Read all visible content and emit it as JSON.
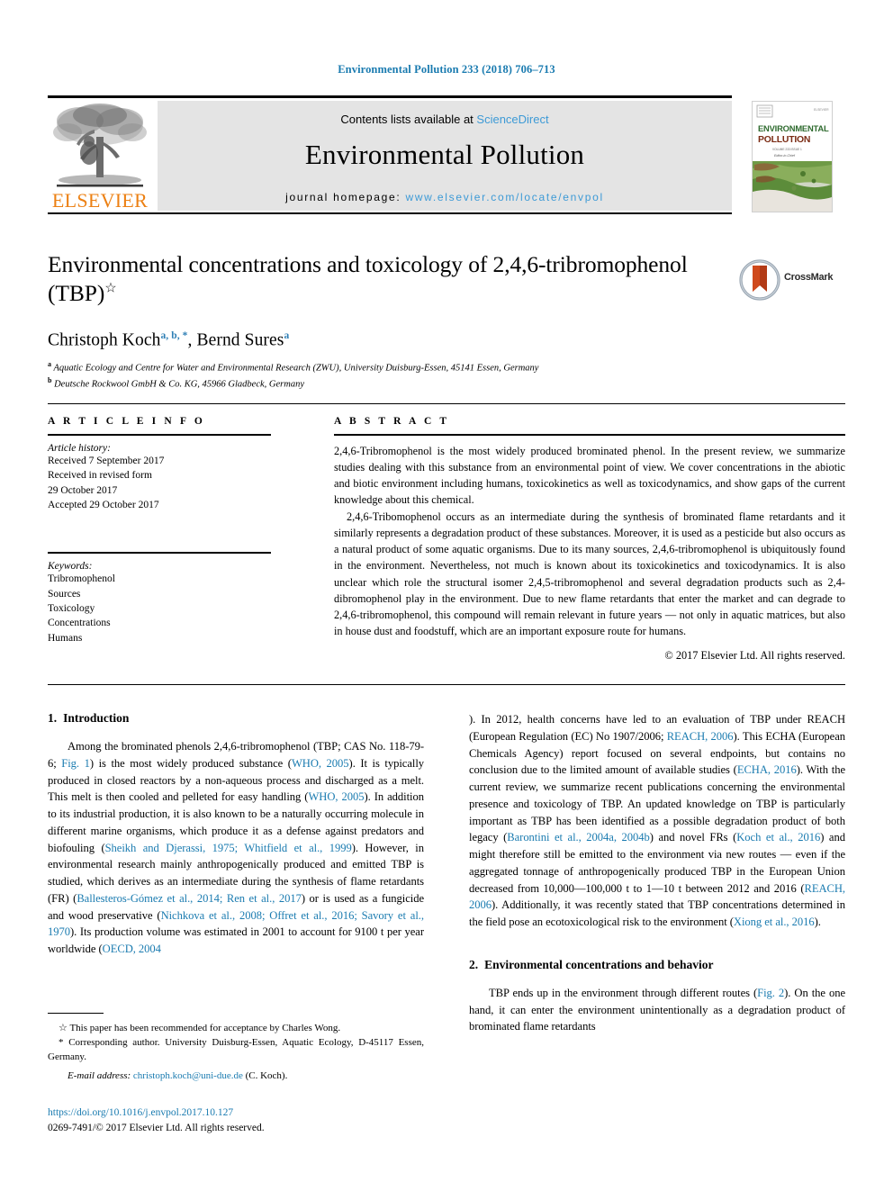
{
  "running_head": "Environmental Pollution 233 (2018) 706–713",
  "masthead": {
    "publisher_name": "ELSEVIER",
    "contents_prefix": "Contents lists available at ",
    "contents_link": "ScienceDirect",
    "journal_title": "Environmental Pollution",
    "homepage_label": "journal homepage: ",
    "homepage_url": "www.elsevier.com/locate/envpol",
    "cover": {
      "line1": "ENVIRONMENTAL",
      "line2": "POLLUTION",
      "publisher_mark": "ELSEVIER"
    }
  },
  "article": {
    "title": "Environmental concentrations and toxicology of 2,4,6-tribromophenol (TBP)",
    "title_line1": "Environmental concentrations and toxicology of 2,4,6-tribromophenol",
    "title_line2": "(TBP)",
    "title_star": "☆",
    "crossmark_label": "CrossMark",
    "authors_text": "Christoph Koch",
    "author1_sup": "a, b, *",
    "authors_text2": ", Bernd Sures",
    "author2_sup": "a",
    "affiliations": [
      {
        "sup": "a",
        "text": "Aquatic Ecology and Centre for Water and Environmental Research (ZWU), University Duisburg-Essen, 45141 Essen, Germany"
      },
      {
        "sup": "b",
        "text": "Deutsche Rockwool GmbH & Co. KG, 45966 Gladbeck, Germany"
      }
    ]
  },
  "article_info": {
    "heading": "A R T I C L E   I N F O",
    "history_label": "Article history:",
    "history": [
      "Received 7 September 2017",
      "Received in revised form",
      "29 October 2017",
      "Accepted 29 October 2017"
    ],
    "keywords_label": "Keywords:",
    "keywords": [
      "Tribromophenol",
      "Sources",
      "Toxicology",
      "Concentrations",
      "Humans"
    ]
  },
  "abstract": {
    "heading": "A B S T R A C T",
    "paragraph1": "2,4,6-Tribromophenol is the most widely produced brominated phenol. In the present review, we summarize studies dealing with this substance from an environmental point of view. We cover concentrations in the abiotic and biotic environment including humans, toxicokinetics as well as toxicodynamics, and show gaps of the current knowledge about this chemical.",
    "paragraph2": "2,4,6-Tribomophenol occurs as an intermediate during the synthesis of brominated flame retardants and it similarly represents a degradation product of these substances. Moreover, it is used as a pesticide but also occurs as a natural product of some aquatic organisms. Due to its many sources, 2,4,6-tribromophenol is ubiquitously found in the environment. Nevertheless, not much is known about its toxicokinetics and toxicodynamics. It is also unclear which role the structural isomer 2,4,5-tribromophenol and several degradation products such as 2,4-dibromophenol play in the environment. Due to new flame retardants that enter the market and can degrade to 2,4,6-tribromophenol, this compound will remain relevant in future years — not only in aquatic matrices, but also in house dust and foodstuff, which are an important exposure route for humans.",
    "rights": "© 2017 Elsevier Ltd. All rights reserved."
  },
  "body": {
    "section1": {
      "number": "1.",
      "title": "Introduction",
      "p1_part1": "Among the brominated phenols 2,4,6-tribromophenol (TBP; CAS No. 118-79-6; ",
      "ref_fig1": "Fig. 1",
      "p1_part2": ") is the most widely produced substance (",
      "ref_who1": "WHO, 2005",
      "p1_part3": "). It is typically produced in closed reactors by a non-aqueous process and discharged as a melt. This melt is then cooled and pelleted for easy handling (",
      "ref_who2": "WHO, 2005",
      "p1_part4": "). In addition to its industrial production, it is also known to be a naturally occurring molecule in different marine organisms, which produce it as a defense against predators and biofouling (",
      "ref_sheikh": "Sheikh and Djerassi, 1975; Whitfield et al., 1999",
      "p1_part5": "). However, in environmental research mainly anthropogenically produced and emitted TBP is studied, which derives as an intermediate during the synthesis of flame retardants (FR) (",
      "ref_ballesteros": "Ballesteros-Gómez et al., 2014; Ren et al., 2017",
      "p1_part6": ") or is used as a fungicide and wood preservative (",
      "ref_nichkova": "Nichkova et al., 2008; Offret et al., 2016; Savory et al., 1970",
      "p1_part7": "). Its production volume was estimated in 2001 to account for 9100 t per year worldwide (",
      "ref_oecd": "OECD, 2004",
      "p1_part8": "). In 2012, health concerns have led to an evaluation of TBP under REACH (European Regulation (EC) No 1907/2006; ",
      "ref_reach1": "REACH, 2006",
      "p1_part9": "). This ECHA (European Chemicals Agency) report focused on several endpoints, but contains no conclusion due to the limited amount of available studies (",
      "ref_echa": "ECHA, 2016",
      "p1_part10": "). With the current review, we summarize recent publications concerning the environmental presence and toxicology of TBP. An updated knowledge on TBP is particularly important as TBP has been identified as a possible degradation product of both legacy (",
      "ref_barontini": "Barontini et al., 2004a, 2004b",
      "p1_part11": ") and novel FRs (",
      "ref_koch": "Koch et al., 2016",
      "p1_part12": ") and might therefore still be emitted to the environment via new routes — even if the aggregated tonnage of anthropogenically produced TBP in the European Union decreased from 10,000—100,000 t to 1—10 t between 2012 and 2016 (",
      "ref_reach2": "REACH, 2006",
      "p1_part13": "). Additionally, it was recently stated that TBP concentrations determined in the field pose an ecotoxicological risk to the environment (",
      "ref_xiong": "Xiong et al., 2016",
      "p1_part14": ")."
    },
    "section2": {
      "number": "2.",
      "title": "Environmental concentrations and behavior",
      "p1_part1": "TBP ends up in the environment through different routes (",
      "ref_fig2": "Fig. 2",
      "p1_part2": "). On the one hand, it can enter the environment unintentionally as a degradation product of brominated flame retardants"
    }
  },
  "footnotes": {
    "star_symbol": "☆",
    "fn1": "This paper has been recommended for acceptance by Charles Wong.",
    "corresponding_symbol": "*",
    "fn2": "Corresponding author. University Duisburg-Essen, Aquatic Ecology, D-45117 Essen, Germany.",
    "email_label": "E-mail address:",
    "email": "christoph.koch@uni-due.de",
    "email_suffix": "(C. Koch)."
  },
  "footer": {
    "doi": "https://doi.org/10.1016/j.envpol.2017.10.127",
    "issn": "0269-7491/© 2017 Elsevier Ltd. All rights reserved."
  },
  "colors": {
    "link_blue": "#1a7bb0",
    "light_link": "#3d9ad6",
    "elsevier_orange": "#ec8013",
    "band_gray": "#e4e4e4"
  }
}
